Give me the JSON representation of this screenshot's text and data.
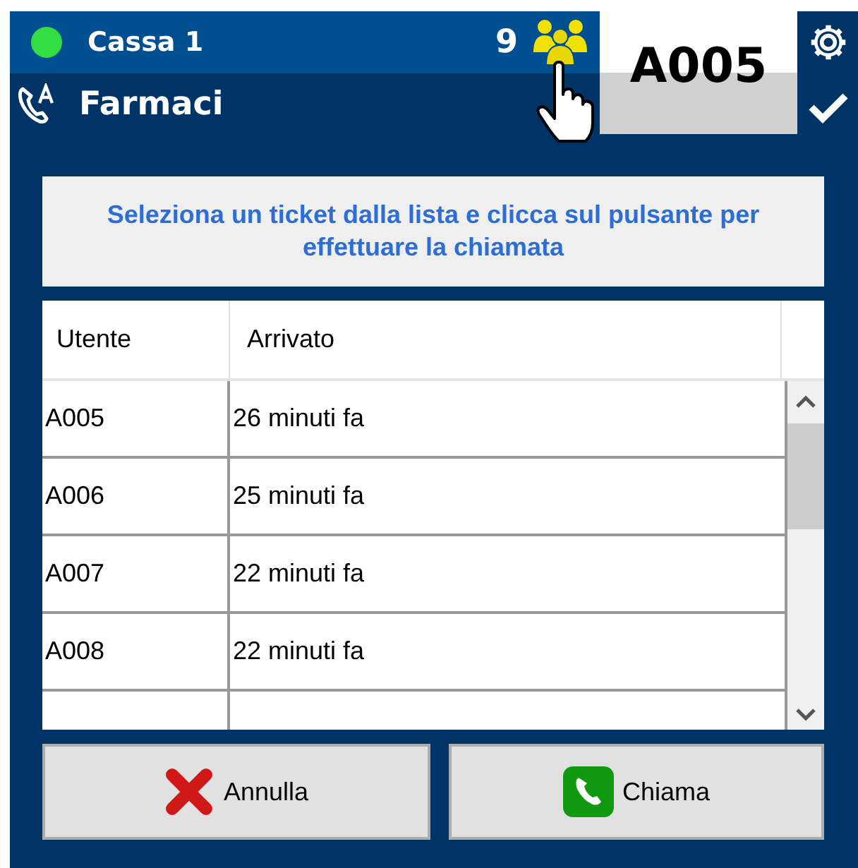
{
  "header": {
    "online": true,
    "title": "Cassa 1",
    "queue_count": "9",
    "service": "Farmaci",
    "current_ticket": "A005"
  },
  "instruction": "Seleziona un ticket dalla lista e clicca sul pulsante per effettuare la chiamata",
  "table": {
    "columns": [
      "Utente",
      "Arrivato"
    ],
    "rows": [
      {
        "user": "A005",
        "arrived": "26 minuti fa"
      },
      {
        "user": "A006",
        "arrived": "25 minuti fa"
      },
      {
        "user": "A007",
        "arrived": "22 minuti fa"
      },
      {
        "user": "A008",
        "arrived": "22 minuti fa"
      }
    ]
  },
  "buttons": [
    {
      "kind": "cancel",
      "label": "Annulla"
    },
    {
      "kind": "call",
      "label": "Chiama"
    }
  ]
}
